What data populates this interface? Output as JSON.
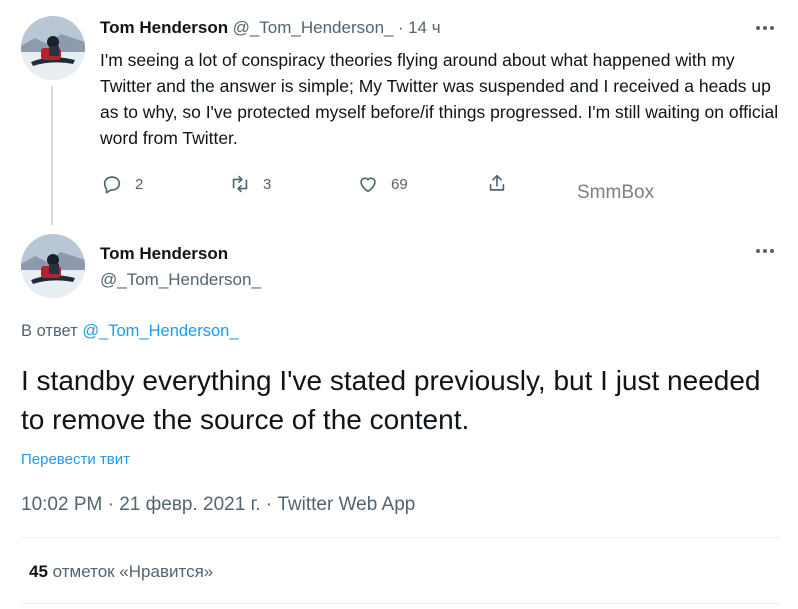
{
  "first_tweet": {
    "author_name": "Tom Henderson",
    "author_handle": "@_Tom_Henderson_",
    "time_sep": "·",
    "time": "14 ч",
    "text": "I'm seeing a lot of conspiracy theories flying around about what happened with my Twitter and the answer is simple; My Twitter was suspended and I received a heads up as to why, so I've protected myself before/if things progressed. I'm still waiting on official word from Twitter.",
    "replies": "2",
    "retweets": "3",
    "likes": "69"
  },
  "watermark": "SmmBox",
  "main_tweet": {
    "author_name": "Tom Henderson",
    "author_handle": "@_Tom_Henderson_",
    "reply_prefix": "В ответ",
    "reply_to": "@_Tom_Henderson_",
    "text": "I standby everything I've stated previously, but I just needed to remove the source of the content.",
    "translate": "Перевести твит",
    "timestamp": "10:02 PM · 21 февр. 2021 г. · Twitter Web App",
    "likes_count": "45",
    "likes_label": "отметок «Нравится»"
  },
  "colors": {
    "accent": "#1d9bf0",
    "secondary_text": "#536471",
    "primary_text": "#0f1419"
  },
  "icons": [
    "reply-icon",
    "retweet-icon",
    "like-icon",
    "share-icon",
    "more-icon"
  ]
}
